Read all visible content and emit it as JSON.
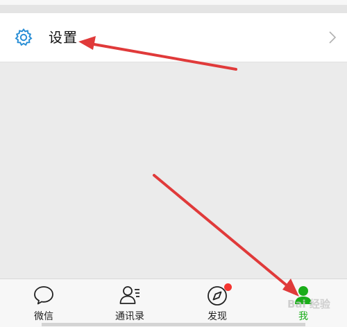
{
  "settings": {
    "label": "设置",
    "icon": "gear-icon",
    "chevron": "chevron-right-icon"
  },
  "tabbar": {
    "tabs": [
      {
        "label": "微信",
        "icon": "chat-bubble-icon",
        "active": false
      },
      {
        "label": "通讯录",
        "icon": "contacts-icon",
        "active": false
      },
      {
        "label": "发现",
        "icon": "compass-icon",
        "active": false,
        "badge": true
      },
      {
        "label": "我",
        "icon": "person-icon",
        "active": true
      }
    ]
  },
  "watermark": {
    "text": "Bai 经验"
  },
  "colors": {
    "accent": "#1aad19",
    "annotation": "#e03a3a",
    "badge": "#f43530"
  }
}
